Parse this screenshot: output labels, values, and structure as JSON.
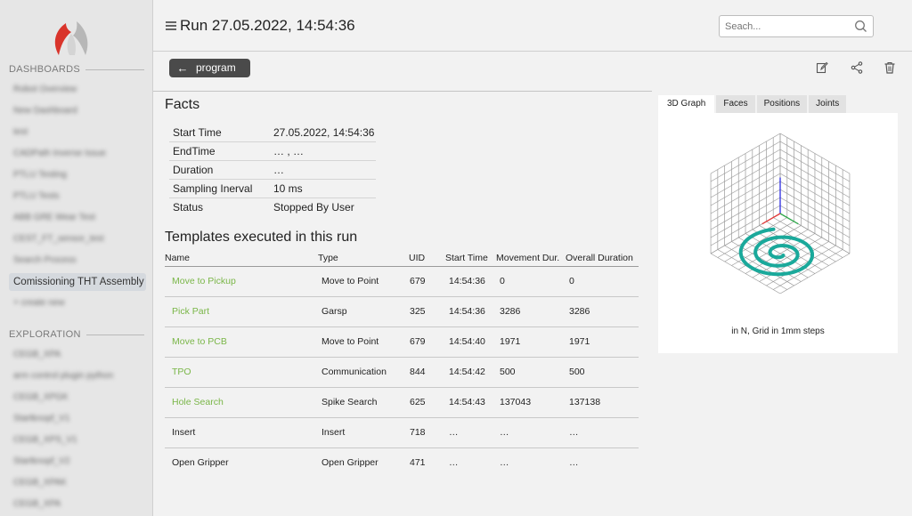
{
  "sidebar": {
    "sections": [
      {
        "title": "DASHBOARDS",
        "items": [
          {
            "label": "Robot Overview",
            "active": false
          },
          {
            "label": "New Dashboard",
            "active": false
          },
          {
            "label": "test",
            "active": false
          },
          {
            "label": "CADPath Inverse Issue",
            "active": false
          },
          {
            "label": "PTLU Testing",
            "active": false
          },
          {
            "label": "PTLU Tests",
            "active": false
          },
          {
            "label": "ABB GRE Wear Test",
            "active": false
          },
          {
            "label": "CEST_FT_sensor_test",
            "active": false
          },
          {
            "label": "Search Process",
            "active": false
          },
          {
            "label": "Comissioning THT Assembly",
            "active": true
          },
          {
            "label": "+ create new",
            "active": false
          }
        ]
      },
      {
        "title": "EXPLORATION",
        "items": [
          {
            "label": "CEGB_XPA",
            "active": false
          },
          {
            "label": "arm control plugin python",
            "active": false
          },
          {
            "label": "CEGB_XPGK",
            "active": false
          },
          {
            "label": "Startknopf_V1",
            "active": false
          },
          {
            "label": "CEGB_XPS_V1",
            "active": false
          },
          {
            "label": "Startknopf_V2",
            "active": false
          },
          {
            "label": "CEGB_XPAK",
            "active": false
          },
          {
            "label": "CEGB_XPA",
            "active": false
          }
        ]
      }
    ]
  },
  "header": {
    "title": "Run 27.05.2022, 14:54:36",
    "search_placeholder": "Seach..."
  },
  "toolbar": {
    "back_label": "program",
    "icons": [
      "edit-icon",
      "share-icon",
      "trash-icon"
    ]
  },
  "facts": {
    "heading": "Facts",
    "rows": [
      {
        "key": "Start Time",
        "value": "27.05.2022, 14:54:36"
      },
      {
        "key": "EndTime",
        "value": "… , …"
      },
      {
        "key": "Duration",
        "value": "…"
      },
      {
        "key": "Sampling Inerval",
        "value": "10 ms"
      },
      {
        "key": "Status",
        "value": "Stopped By User"
      }
    ]
  },
  "templates": {
    "heading": "Templates executed in this run",
    "columns": [
      "Name",
      "Type",
      "UID",
      "Start Time",
      "Movement Dur.",
      "Overall Duration"
    ],
    "rows": [
      {
        "name": "Move to Pickup",
        "type": "Move to Point",
        "uid": "679",
        "start": "14:54:36",
        "movement": "0",
        "overall": "0",
        "link": true
      },
      {
        "name": "Pick Part",
        "type": "Garsp",
        "uid": "325",
        "start": "14:54:36",
        "movement": "3286",
        "overall": "3286",
        "link": true
      },
      {
        "name": "Move to PCB",
        "type": "Move to Point",
        "uid": "679",
        "start": "14:54:40",
        "movement": "1971",
        "overall": "1971",
        "link": true
      },
      {
        "name": "TPO",
        "type": "Communication",
        "uid": "844",
        "start": "14:54:42",
        "movement": "500",
        "overall": "500",
        "link": true
      },
      {
        "name": "Hole Search",
        "type": "Spike Search",
        "uid": "625",
        "start": "14:54:43",
        "movement": "137043",
        "overall": "137138",
        "link": true
      },
      {
        "name": "Insert",
        "type": "Insert",
        "uid": "718",
        "start": "…",
        "movement": "…",
        "overall": "…",
        "link": false
      },
      {
        "name": "Open Gripper",
        "type": "Open Gripper",
        "uid": "471",
        "start": "…",
        "movement": "…",
        "overall": "…",
        "link": false
      }
    ]
  },
  "graph": {
    "tabs": [
      {
        "label": "3D Graph",
        "active": true
      },
      {
        "label": "Faces",
        "active": false
      },
      {
        "label": "Positions",
        "active": false
      },
      {
        "label": "Joints",
        "active": false
      }
    ],
    "caption": "in N, Grid in 1mm steps"
  },
  "colors": {
    "accent_green": "#7ab648",
    "spiral": "#1aa99b",
    "button_dark": "#4a4a4a"
  }
}
